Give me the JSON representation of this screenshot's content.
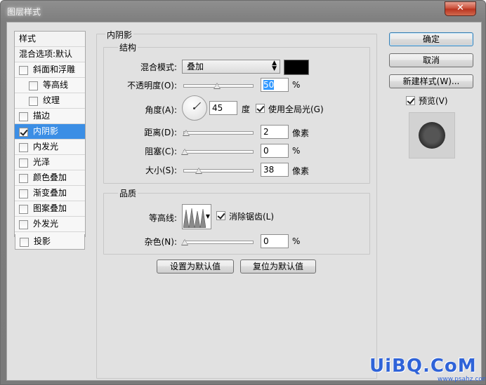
{
  "window": {
    "title": "图层样式",
    "close_glyph": "✕"
  },
  "sidebar": {
    "header": "样式",
    "blend_options": "混合选项:默认",
    "items": [
      {
        "label": "斜面和浮雕",
        "checked": false
      },
      {
        "label": "等高线",
        "checked": false
      },
      {
        "label": "纹理",
        "checked": false
      },
      {
        "label": "描边",
        "checked": false
      },
      {
        "label": "内阴影",
        "checked": true
      },
      {
        "label": "内发光",
        "checked": false
      },
      {
        "label": "光泽",
        "checked": false
      },
      {
        "label": "颜色叠加",
        "checked": false
      },
      {
        "label": "渐变叠加",
        "checked": false
      },
      {
        "label": "图案叠加",
        "checked": false
      },
      {
        "label": "外发光",
        "checked": false
      },
      {
        "label": "投影",
        "checked": false
      }
    ]
  },
  "panel": {
    "title": "内阴影",
    "structure": {
      "title": "结构",
      "blend_mode_label": "混合模式:",
      "blend_mode_value": "叠加",
      "shadow_color": "#000000",
      "opacity_label": "不透明度(O):",
      "opacity_value": "50",
      "opacity_unit": "%",
      "angle_label": "角度(A):",
      "angle_value": "45",
      "angle_unit": "度",
      "global_light_label": "使用全局光(G)",
      "global_light_checked": true,
      "distance_label": "距离(D):",
      "distance_value": "2",
      "distance_unit": "像素",
      "choke_label": "阻塞(C):",
      "choke_value": "0",
      "choke_unit": "%",
      "size_label": "大小(S):",
      "size_value": "38",
      "size_unit": "像素"
    },
    "quality": {
      "title": "品质",
      "contour_label": "等高线:",
      "antialias_label": "消除锯齿(L)",
      "antialias_checked": true,
      "noise_label": "杂色(N):",
      "noise_value": "0",
      "noise_unit": "%"
    },
    "make_default": "设置为默认值",
    "reset_default": "复位为默认值"
  },
  "buttons": {
    "ok": "确定",
    "cancel": "取消",
    "new_style": "新建样式(W)...",
    "preview_label": "预览(V)",
    "preview_checked": true
  },
  "watermark": {
    "text": "UiBQ.CoM",
    "sub": "www.psahz.com"
  }
}
